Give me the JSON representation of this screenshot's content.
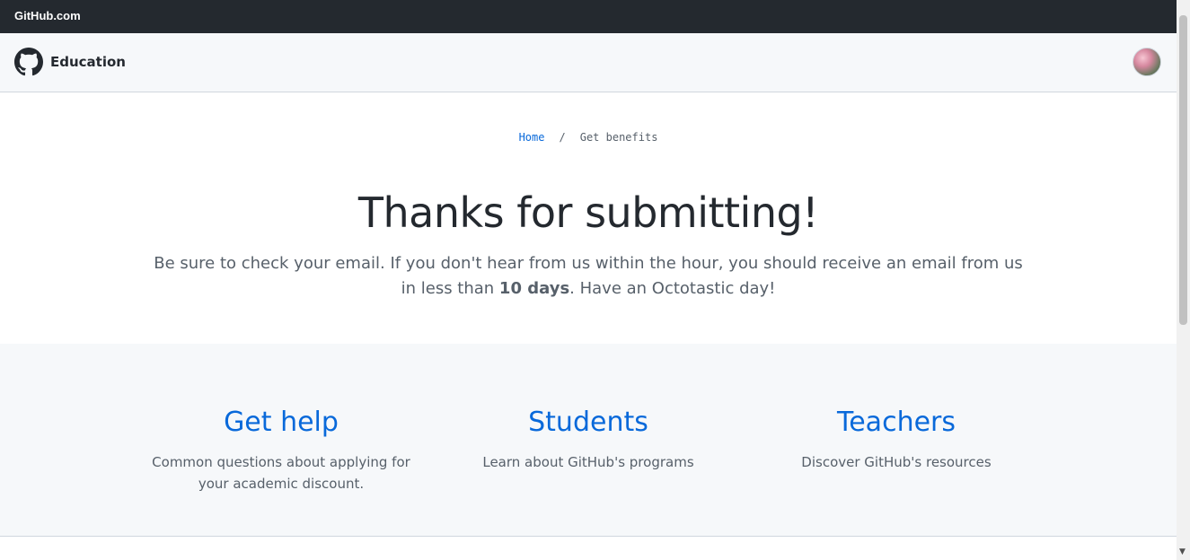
{
  "topbar": {
    "title": "GitHub.com"
  },
  "header": {
    "title": "Education",
    "logo_icon": "github-logo-icon",
    "avatar_icon": "user-avatar"
  },
  "breadcrumb": {
    "home": "Home",
    "separator": "/",
    "current": "Get benefits"
  },
  "hero": {
    "title": "Thanks for submitting!",
    "text_before": "Be sure to check your email. If you don't hear from us within the hour, you should receive an email from us in less than ",
    "text_bold": "10 days",
    "text_after": ". Have an Octotastic day!"
  },
  "links": [
    {
      "title": "Get help",
      "description": "Common questions about applying for your academic discount."
    },
    {
      "title": "Students",
      "description": "Learn about GitHub's programs"
    },
    {
      "title": "Teachers",
      "description": "Discover GitHub's resources"
    }
  ],
  "colors": {
    "link": "#0969da",
    "topbar": "#24292f",
    "muted": "#57606a",
    "panel": "#f6f8fa"
  }
}
